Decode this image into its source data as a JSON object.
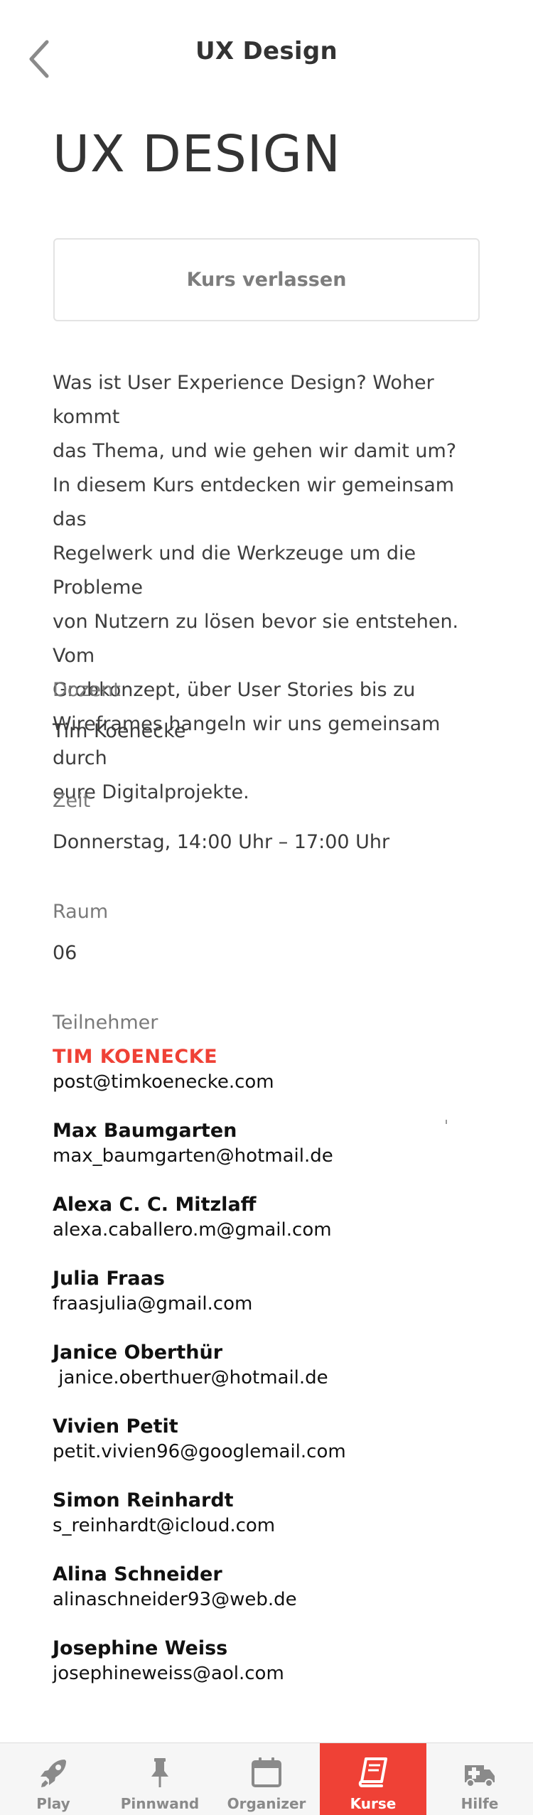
{
  "header": {
    "title": "UX Design"
  },
  "course": {
    "title": "UX DESIGN",
    "leave_label": "Kurs verlassen",
    "description_lines": [
      "Was ist User Experience Design? Woher kommt",
      "das Thema, und wie gehen wir damit um?",
      "In diesem Kurs entdecken wir gemeinsam das",
      "Regelwerk und die Werkzeuge um die Probleme",
      "von Nutzern zu lösen bevor sie entstehen. Vom",
      "Grobkonzept, über User Stories bis zu",
      "Wireframes hangeln wir uns gemeinsam durch",
      "eure Digitalprojekte."
    ]
  },
  "details": {
    "lecturer_label": "Dozent",
    "lecturer_value": "Tim Koenecke",
    "time_label": "Zeit",
    "time_value": "Donnerstag, 14:00 Uhr – 17:00 Uhr",
    "room_label": "Raum",
    "room_value": "06",
    "participants_label": "Teilnehmer"
  },
  "participants": [
    {
      "name": "TIM KOENECKE",
      "email": "post@timkoenecke.com"
    },
    {
      "name": "Max Baumgarten",
      "email": "max_baumgarten@hotmail.de"
    },
    {
      "name": "Alexa C. C. Mitzlaff",
      "email": "alexa.caballero.m@gmail.com"
    },
    {
      "name": "Julia Fraas",
      "email": "fraasjulia@gmail.com"
    },
    {
      "name": "Janice Oberthür",
      "email": " janice.oberthuer@hotmail.de"
    },
    {
      "name": "Vivien Petit",
      "email": "petit.vivien96@googlemail.com"
    },
    {
      "name": "Simon Reinhardt",
      "email": "s_reinhardt@icloud.com"
    },
    {
      "name": "Alina Schneider",
      "email": "alinaschneider93@web.de"
    },
    {
      "name": "Josephine Weiss",
      "email": "josephineweiss@aol.com"
    }
  ],
  "tabbar": {
    "tabs": [
      {
        "label": "Play",
        "icon": "rocket-icon",
        "active": false
      },
      {
        "label": "Pinnwand",
        "icon": "pushpin-icon",
        "active": false
      },
      {
        "label": "Organizer",
        "icon": "calendar-icon",
        "active": false
      },
      {
        "label": "Kurse",
        "icon": "book-icon",
        "active": true
      },
      {
        "label": "Hilfe",
        "icon": "ambulance-icon",
        "active": false
      }
    ]
  },
  "colors": {
    "accent": "#ef4136",
    "text": "#333333",
    "muted": "#7a7a7a",
    "tabbar_bg": "#f6f6f6"
  }
}
